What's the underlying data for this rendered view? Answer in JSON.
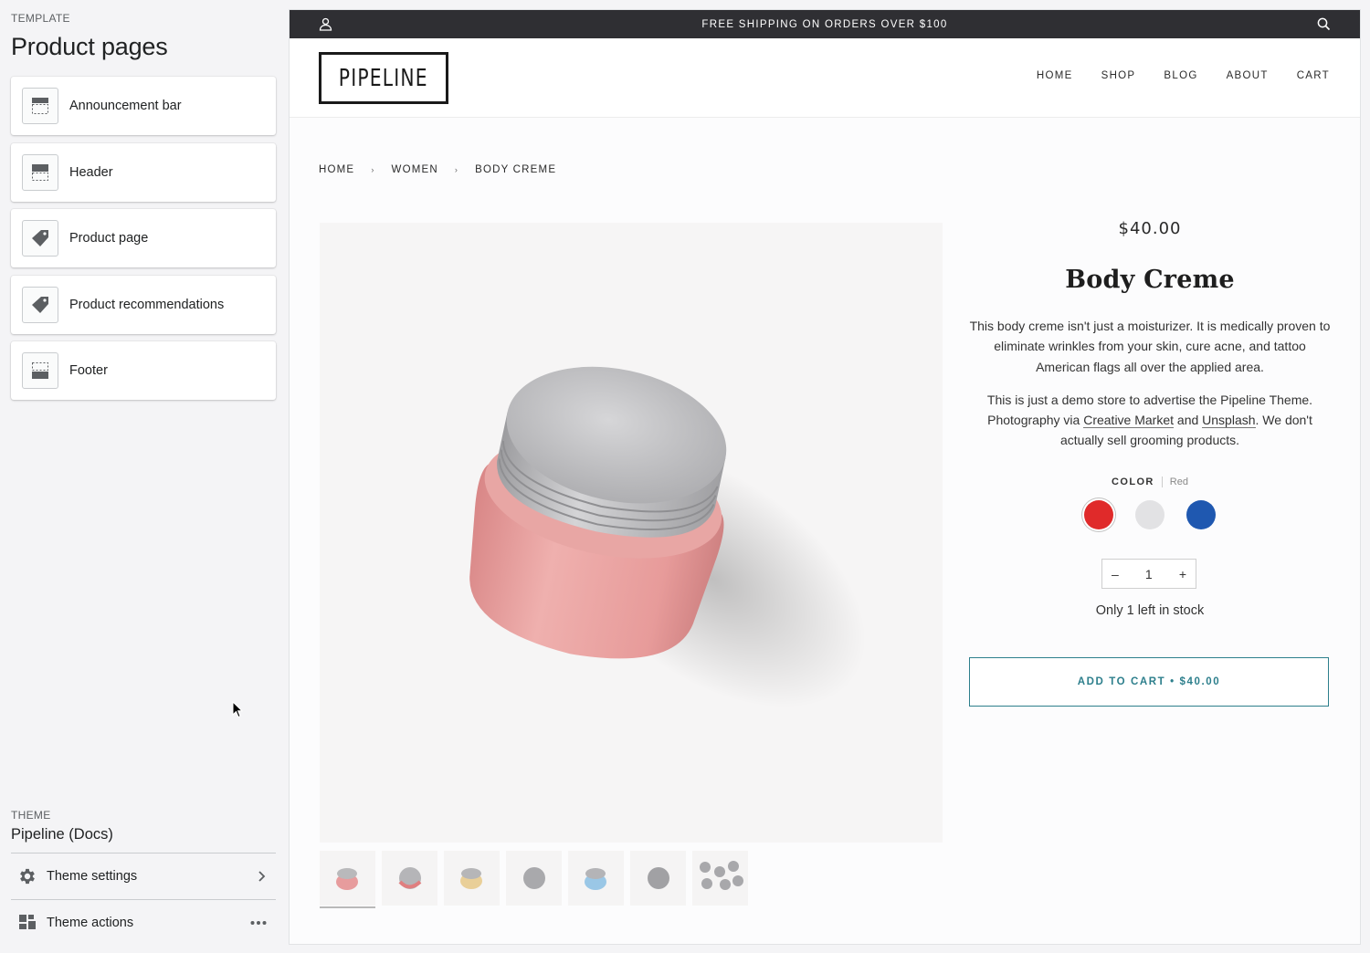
{
  "sidebar": {
    "eyebrow": "TEMPLATE",
    "title": "Product pages",
    "sections": [
      {
        "label": "Announcement bar",
        "icon": "announcement-bar-icon"
      },
      {
        "label": "Header",
        "icon": "header-icon"
      },
      {
        "label": "Product page",
        "icon": "tag-icon"
      },
      {
        "label": "Product recommendations",
        "icon": "tag-icon"
      },
      {
        "label": "Footer",
        "icon": "footer-icon"
      }
    ],
    "theme": {
      "eyebrow": "THEME",
      "name": "Pipeline (Docs)",
      "settings_label": "Theme settings",
      "actions_label": "Theme actions"
    }
  },
  "store": {
    "announcement": "FREE SHIPPING ON ORDERS OVER $100",
    "logo": "PIPELINE",
    "nav": [
      "HOME",
      "SHOP",
      "BLOG",
      "ABOUT",
      "CART"
    ],
    "breadcrumbs": [
      "HOME",
      "WOMEN",
      "BODY CREME"
    ],
    "product": {
      "price": "$40.00",
      "title": "Body Creme",
      "description_1": "This body creme isn't just a moisturizer.  It is medically proven to eliminate wrinkles from your skin, cure acne, and tattoo American flags all over the applied area.",
      "description_2_pre": "This is just a demo store to advertise the Pipeline Theme.  Photography via ",
      "link_1": "Creative Market",
      "description_2_mid": " and ",
      "link_2": "Unsplash",
      "description_2_post": ".  We don't actually sell grooming products.",
      "color_label": "COLOR",
      "color_value": "Red",
      "swatches": [
        {
          "name": "Red",
          "hex": "#e02a2a",
          "selected": true
        },
        {
          "name": "White",
          "hex": "#e2e2e4",
          "selected": false
        },
        {
          "name": "Blue",
          "hex": "#1f58b0",
          "selected": false
        }
      ],
      "qty_minus": "–",
      "quantity": "1",
      "qty_plus": "+",
      "stock": "Only 1 left in stock",
      "add_to_cart": "ADD TO CART • $40.00"
    }
  },
  "colors": {
    "accent": "#2d7f8c",
    "announcement_bg": "#2f2f33",
    "jar_body": "#eba3a3",
    "jar_lid": "#c4c4c6"
  }
}
